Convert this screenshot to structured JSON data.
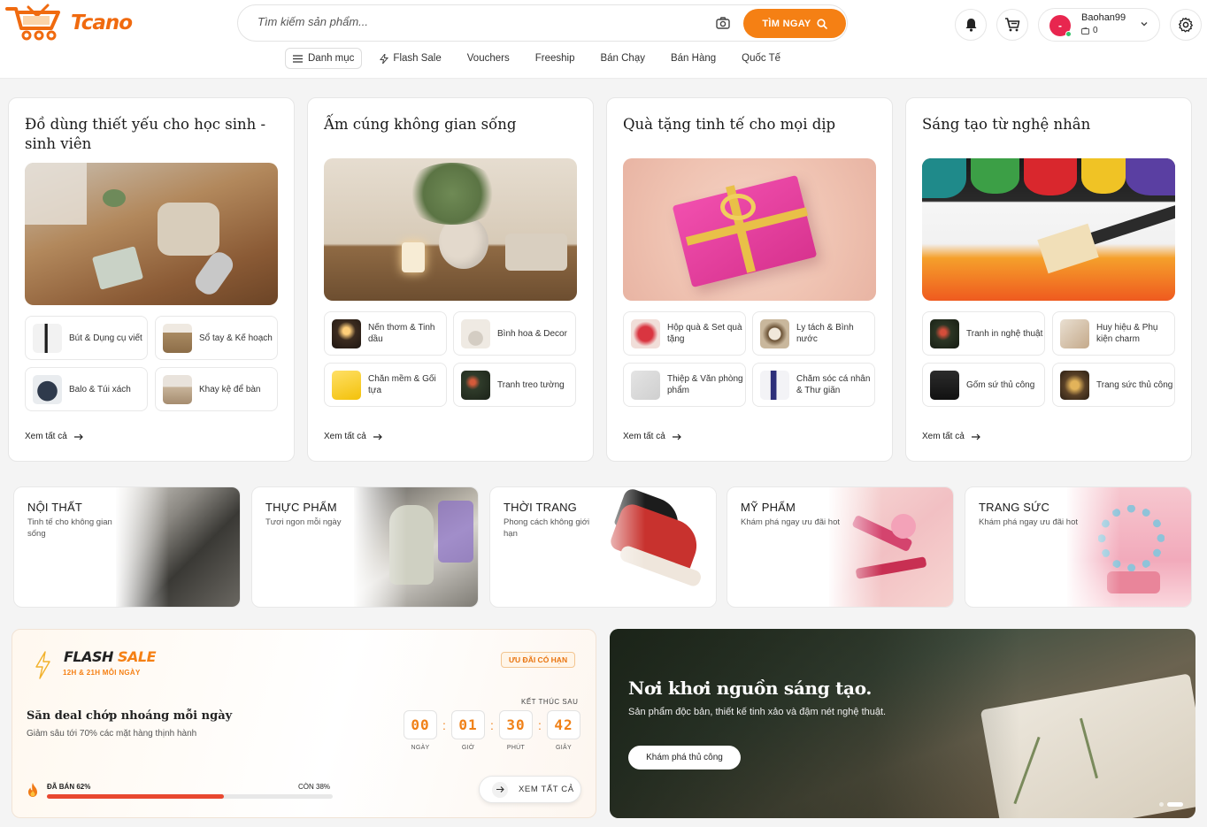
{
  "header": {
    "logo_text": "Tcano",
    "search_placeholder": "Tìm kiếm sản phẩm...",
    "search_button": "TÌM NGAY",
    "nav": {
      "category": "Danh mục",
      "items": [
        "Flash Sale",
        "Vouchers",
        "Freeship",
        "Bán Chạy",
        "Bán Hàng",
        "Quốc Tế"
      ]
    },
    "user": {
      "avatar_initial": "-",
      "name": "Baohan99",
      "coins": "0"
    },
    "icons": [
      "bell-icon",
      "cart-icon",
      "gear-icon",
      "camera-icon",
      "search-icon"
    ]
  },
  "collections": [
    {
      "title": "Đồ dùng thiết yếu cho học sinh - sinh viên",
      "items": [
        "Bút & Dụng cụ viết",
        "Sổ tay & Kế hoạch",
        "Balo & Túi xách",
        "Khay kệ để bàn"
      ],
      "see_all": "Xem tất cả"
    },
    {
      "title": "Ấm cúng không gian sống",
      "items": [
        "Nến thơm & Tinh dầu",
        "Bình hoa & Decor",
        "Chăn mềm & Gối tựa",
        "Tranh treo tường"
      ],
      "see_all": "Xem tất cả"
    },
    {
      "title": "Quà tặng tinh tế cho mọi dịp",
      "items": [
        "Hộp quà & Set quà tặng",
        "Ly tách & Bình nước",
        "Thiệp & Văn phòng phẩm",
        "Chăm sóc cá nhân & Thư giãn"
      ],
      "see_all": "Xem tất cả"
    },
    {
      "title": "Sáng tạo từ nghệ nhân",
      "items": [
        "Tranh in nghệ thuật",
        "Huy hiệu & Phụ kiện charm",
        "Gốm sứ thủ công",
        "Trang sức thủ công"
      ],
      "see_all": "Xem tất cả"
    }
  ],
  "banners": [
    {
      "title": "NỘI THẤT",
      "desc": "Tinh tế cho không gian sống"
    },
    {
      "title": "THỰC PHẨM",
      "desc": "Tươi ngon mỗi ngày"
    },
    {
      "title": "THỜI TRANG",
      "desc": "Phong cách không giới hạn"
    },
    {
      "title": "MỸ PHẨM",
      "desc": "Khám phá ngay ưu đãi hot"
    },
    {
      "title": "TRANG SỨC",
      "desc": "Khám phá ngay ưu đãi hot"
    }
  ],
  "flash_sale": {
    "title_a": "FLASH",
    "title_b": "SALE",
    "subtitle": "12H & 21H MỖI NGÀY",
    "badge": "ƯU ĐÃI CÓ HẠN",
    "heading": "Săn deal chớp nhoáng mỗi ngày",
    "desc": "Giảm sâu tới 70% các mặt hàng thịnh hành",
    "ends_label": "KẾT THÚC SAU",
    "timer": [
      {
        "value": "00",
        "label": "NGÀY"
      },
      {
        "value": "01",
        "label": "GIỜ"
      },
      {
        "value": "30",
        "label": "PHÚT"
      },
      {
        "value": "42",
        "label": "GIÂY"
      }
    ],
    "sold_label": "ĐÃ BÁN 62%",
    "remain_label": "CÒN 38%",
    "sold_fraction": 0.62,
    "button": "XEM TẤT CẢ"
  },
  "promo": {
    "title": "Nơi khơi nguồn sáng tạo.",
    "desc": "Sản phẩm độc bản, thiết kế tinh xảo và đậm nét nghệ thuật.",
    "button": "Khám phá thủ công"
  },
  "colors": {
    "accent": "#f58014",
    "danger": "#e94830"
  }
}
